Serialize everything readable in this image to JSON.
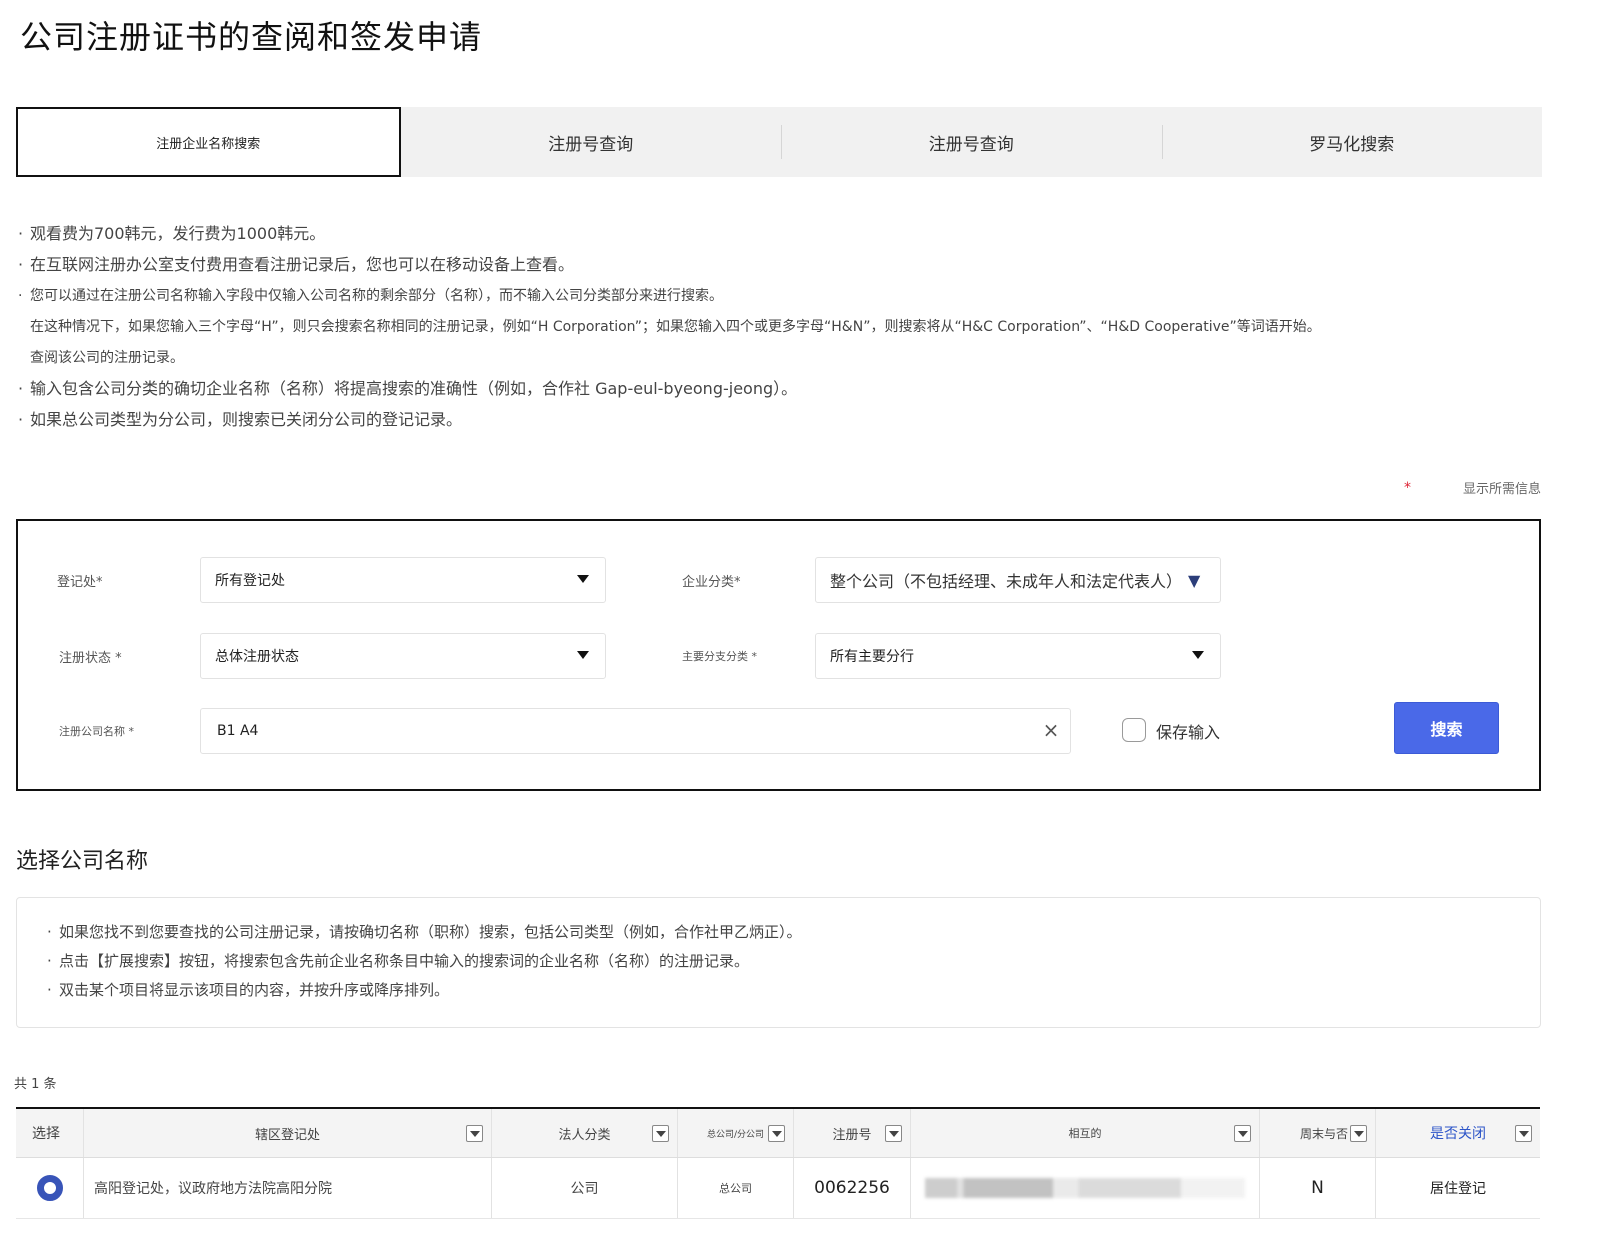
{
  "page": {
    "title": "公司注册证书的查阅和签发申请"
  },
  "tabs": [
    {
      "label": "注册企业名称搜索",
      "active": true
    },
    {
      "label": "注册号查询",
      "active": false
    },
    {
      "label": "注册号查询",
      "active": false
    },
    {
      "label": "罗马化搜索",
      "active": false
    }
  ],
  "notes": [
    "观看费为700韩元，发行费为1000韩元。",
    "在互联网注册办公室支付费用查看注册记录后，您也可以在移动设备上查看。",
    "您可以通过在注册公司名称输入字段中仅输入公司名称的剩余部分（名称），而不输入公司分类部分来进行搜索。",
    "在这种情况下，如果您输入三个字母“H”，则只会搜索名称相同的注册记录，例如“H Corporation”；如果您输入四个或更多字母“H&N”，则搜索将从“H&C Corporation”、“H&D Cooperative”等词语开始。",
    "查阅该公司的注册记录。",
    "输入包含公司分类的确切企业名称（名称）将提高搜索的准确性（例如，合作社 Gap-eul-byeong-jeong）。",
    "如果总公司类型为分公司，则搜索已关闭分公司的登记记录。"
  ],
  "required_note": {
    "star": "*",
    "text": "显示所需信息"
  },
  "search": {
    "registry_label": "登记处*",
    "registry_value": "所有登记处",
    "company_type_label": "企业分类*",
    "company_type_value": "整个公司（不包括经理、未成年人和法定代表人）",
    "company_type_arrow": "▼",
    "status_label": "注册状态 *",
    "status_value": "总体注册状态",
    "branch_label": "主要分支分类 *",
    "branch_value": "所有主要分行",
    "name_label": "注册公司名称 *",
    "name_value": "B1 A4",
    "clear_icon": "×",
    "save_input_label": "保存输入",
    "search_button": "搜索"
  },
  "select_section": {
    "title": "选择公司名称",
    "info": [
      "如果您找不到您要查找的公司注册记录，请按确切名称（职称）搜索，包括公司类型（例如，合作社甲乙炳正）。",
      "点击【扩展搜索】按钮，将搜索包含先前企业名称条目中输入的搜索词的企业名称（名称）的注册记录。",
      "双击某个项目将显示该项目的内容，并按升序或降序排列。"
    ]
  },
  "results": {
    "count_text": "共 1 条",
    "columns": [
      "选择",
      "辖区登记处",
      "法人分类",
      "总公司/分公司",
      "注册号",
      "相互的",
      "周末与否",
      "是否关闭"
    ],
    "rows": [
      {
        "registry": "高阳登记处，议政府地方法院高阳分院",
        "corp_type": "公司",
        "hq_branch": "总公司",
        "reg_no": "0062256",
        "weekend": "N",
        "closed": "居住登记"
      }
    ]
  },
  "colors": {
    "accent": "#4a69e8",
    "radio": "#3854b8",
    "required": "#dd2233"
  }
}
